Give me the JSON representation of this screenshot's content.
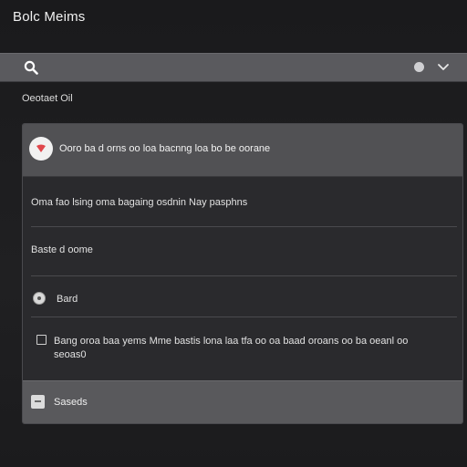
{
  "app": {
    "title": "Bolc Meims"
  },
  "search": {
    "placeholder": ""
  },
  "section": {
    "label": "Oeotaet Oil"
  },
  "card": {
    "header_text": "Ooro ba d orns oo loa bacnng loa bo be oorane",
    "row1_text": "Oma fao lsing oma bagaing osdnin Nay pasphns",
    "row2_text": "Baste d oome",
    "radio_label": "Bard",
    "checkbox_label": "Bang oroa baa yems Mme bastis lona laa tfa oo oa baad oroans oo ba oeanl oo seoas0",
    "footer_label": "Saseds"
  },
  "colors": {
    "background": "#1c1c1e",
    "search_bar": "#5a5a5e",
    "card_header": "#515154",
    "card_body": "#2a2a2d",
    "card_footer": "#59595c",
    "alert_accent": "#e0474c"
  },
  "icons": {
    "search": "search-icon",
    "chevron": "chevron-down-icon",
    "alert": "alert-icon",
    "footer": "minus-square-icon"
  }
}
